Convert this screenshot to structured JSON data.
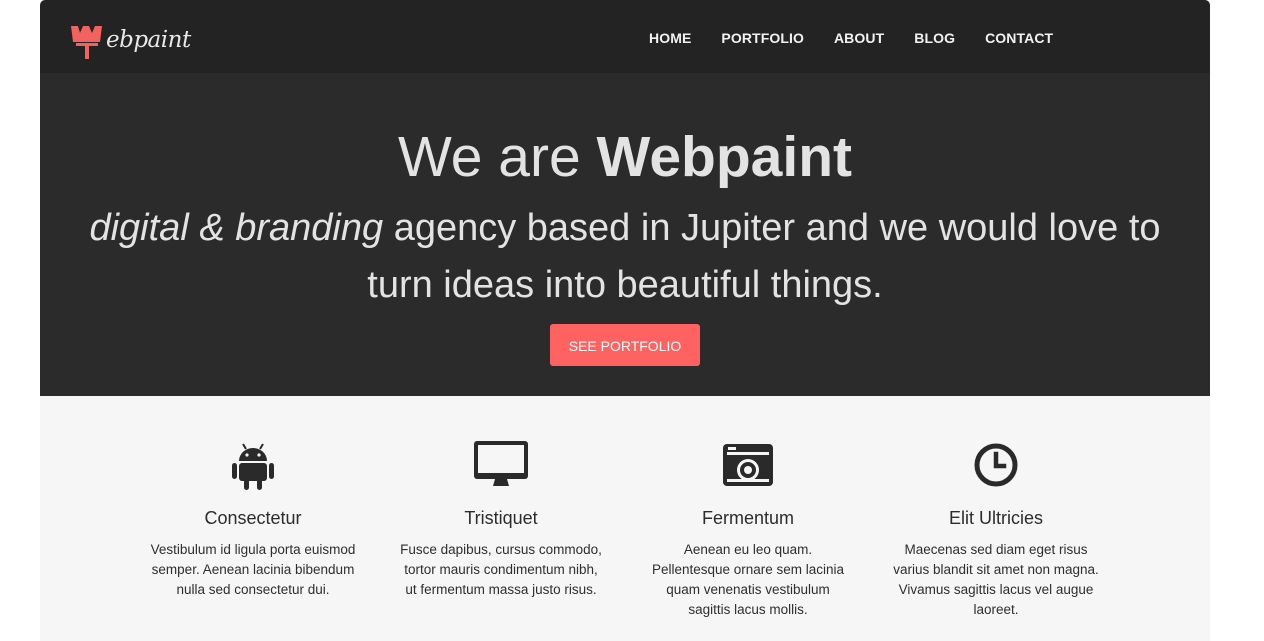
{
  "header": {
    "logo_text": "ebpaint",
    "logo_color": "#f2625f",
    "nav": [
      "HOME",
      "PORTFOLIO",
      "ABOUT",
      "BLOG",
      "CONTACT"
    ]
  },
  "hero": {
    "title_prefix": "We are",
    "title_brand": "Webpaint",
    "sub_italic": "digital & branding",
    "sub_rest_line1": "agency based in Jupiter and we would love to",
    "sub_line2": "turn ideas into beautiful things.",
    "cta_label": "SEE PORTFOLIO",
    "cta_color": "#ff6361"
  },
  "features": [
    {
      "icon": "android-icon",
      "title": "Consectetur",
      "lines": [
        "Vestibulum id ligula porta euismod",
        "semper. Aenean lacinia bibendum",
        "nulla sed consectetur dui."
      ]
    },
    {
      "icon": "monitor-icon",
      "title": "Tristiquet",
      "lines": [
        "Fusce dapibus, cursus commodo,",
        "tortor mauris condimentum nibh,",
        "ut fermentum massa justo risus."
      ]
    },
    {
      "icon": "camera-icon",
      "title": "Fermentum",
      "lines": [
        "Aenean eu leo quam.",
        "Pellentesque ornare sem lacinia",
        "quam venenatis vestibulum",
        "sagittis lacus mollis."
      ]
    },
    {
      "icon": "clock-icon",
      "title": "Elit Ultricies",
      "lines": [
        "Maecenas sed diam eget risus",
        "varius blandit sit amet non magna.",
        "Vivamus sagittis lacus vel augue",
        "laoreet."
      ]
    }
  ]
}
